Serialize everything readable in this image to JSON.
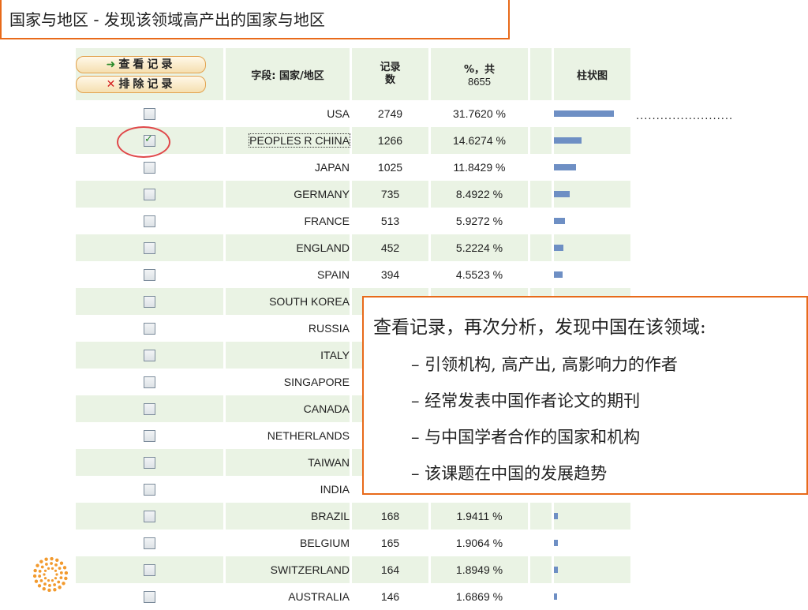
{
  "page": {
    "title": "国家与地区 - 发现该领域高产出的国家与地区"
  },
  "table": {
    "view_records_label": "查看记录",
    "exclude_records_label": "排除记录",
    "col_field": "字段: 国家/地区",
    "col_count": "记录数",
    "col_percent_line1": "%，共",
    "col_percent_line2": "8655",
    "col_chart": "柱状图",
    "rows": [
      {
        "country": "USA",
        "count": "2749",
        "percent": "31.7620 %",
        "share": 0.3176,
        "checked": false
      },
      {
        "country": "PEOPLES R CHINA",
        "count": "1266",
        "percent": "14.6274 %",
        "share": 0.1463,
        "checked": true
      },
      {
        "country": "JAPAN",
        "count": "1025",
        "percent": "11.8429 %",
        "share": 0.1184,
        "checked": false
      },
      {
        "country": "GERMANY",
        "count": "735",
        "percent": "8.4922 %",
        "share": 0.0849,
        "checked": false
      },
      {
        "country": "FRANCE",
        "count": "513",
        "percent": "5.9272 %",
        "share": 0.0593,
        "checked": false
      },
      {
        "country": "ENGLAND",
        "count": "452",
        "percent": "5.2224 %",
        "share": 0.0522,
        "checked": false
      },
      {
        "country": "SPAIN",
        "count": "394",
        "percent": "4.5523 %",
        "share": 0.0455,
        "checked": false
      },
      {
        "country": "SOUTH KOREA",
        "count": "",
        "percent": "",
        "share": 0,
        "checked": false
      },
      {
        "country": "RUSSIA",
        "count": "",
        "percent": "",
        "share": 0,
        "checked": false
      },
      {
        "country": "ITALY",
        "count": "",
        "percent": "",
        "share": 0,
        "checked": false
      },
      {
        "country": "SINGAPORE",
        "count": "",
        "percent": "",
        "share": 0,
        "checked": false
      },
      {
        "country": "CANADA",
        "count": "",
        "percent": "",
        "share": 0,
        "checked": false
      },
      {
        "country": "NETHERLANDS",
        "count": "",
        "percent": "",
        "share": 0,
        "checked": false
      },
      {
        "country": "TAIWAN",
        "count": "",
        "percent": "",
        "share": 0,
        "checked": false
      },
      {
        "country": "INDIA",
        "count": "",
        "percent": "",
        "share": 0,
        "checked": false
      },
      {
        "country": "BRAZIL",
        "count": "168",
        "percent": "1.9411 %",
        "share": 0.0194,
        "checked": false
      },
      {
        "country": "BELGIUM",
        "count": "165",
        "percent": "1.9064 %",
        "share": 0.0191,
        "checked": false
      },
      {
        "country": "SWITZERLAND",
        "count": "164",
        "percent": "1.8949 %",
        "share": 0.0189,
        "checked": false
      },
      {
        "country": "AUSTRALIA",
        "count": "146",
        "percent": "1.6869 %",
        "share": 0.0169,
        "checked": false
      }
    ]
  },
  "leader_dots": "........................",
  "callout": {
    "title": "查看记录，再次分析，发现中国在该领域:",
    "items": [
      "– 引领机构, 高产出, 高影响力的作者",
      "– 经常发表中国作者论文的期刊",
      "– 与中国学者合作的国家和机构",
      "– 该课题在中国的发展趋势"
    ]
  },
  "colors": {
    "accent": "#e86a1a",
    "header_bg": "#eaf3e4",
    "bar": "#6e8fc4",
    "highlight_circle": "#e0484a"
  }
}
